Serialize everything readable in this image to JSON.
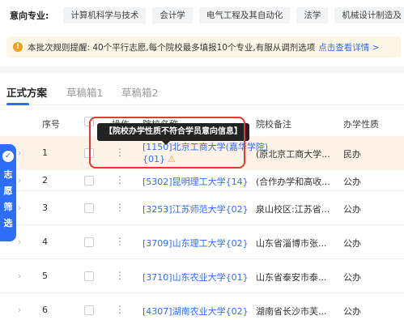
{
  "major": {
    "label": "意向专业:",
    "tags": [
      "计算机科学与技术",
      "会计学",
      "电气工程及其自动化",
      "法学",
      "机械设计制造及"
    ]
  },
  "notice": {
    "text": "本批次规则提醒: 40个平行志愿,每个院校最多填报10个专业,有服从调剂选项",
    "link": "点击查看详情 >"
  },
  "tabs": [
    "正式方案",
    "草稿箱1",
    "草稿箱2"
  ],
  "table": {
    "headers": {
      "index": "序号",
      "action": "操作",
      "school": "院校名称",
      "remark": "院校备注",
      "nature": "办学性质"
    },
    "rows": [
      {
        "index": "1",
        "school_line1": "[1150]北京工商大学(嘉华学院)",
        "school_line2": "{01}",
        "remark": "(原北京工商大学...",
        "nature": "民办"
      },
      {
        "index": "2",
        "school": "[5302]昆明理工大学{14}",
        "remark": "(合作办学和高收...",
        "nature": "公办"
      },
      {
        "index": "3",
        "school": "[3253]江苏师范大学{02}",
        "remark": "泉山校区:江苏省...",
        "nature": "公办"
      },
      {
        "index": "4",
        "school": "[3709]山东理工大学{02}",
        "remark": "山东省淄博市张...",
        "nature": "公办"
      },
      {
        "index": "5",
        "school": "[3710]山东农业大学{01}",
        "remark": "山东省泰安市泰...",
        "nature": "公办"
      },
      {
        "index": "6",
        "school": "[4307]湖南农业大学{02}",
        "remark": "湖南省长沙市芙...",
        "nature": "公办"
      }
    ]
  },
  "tooltip": "【院校办学性质不符合学员意向信息】",
  "side_badge": {
    "text": "志愿筛选"
  },
  "colors": {
    "accent": "#2f6df6",
    "warning": "#f0a020",
    "highlight_bg": "#fdf3e7",
    "alert_border": "#e53935"
  }
}
